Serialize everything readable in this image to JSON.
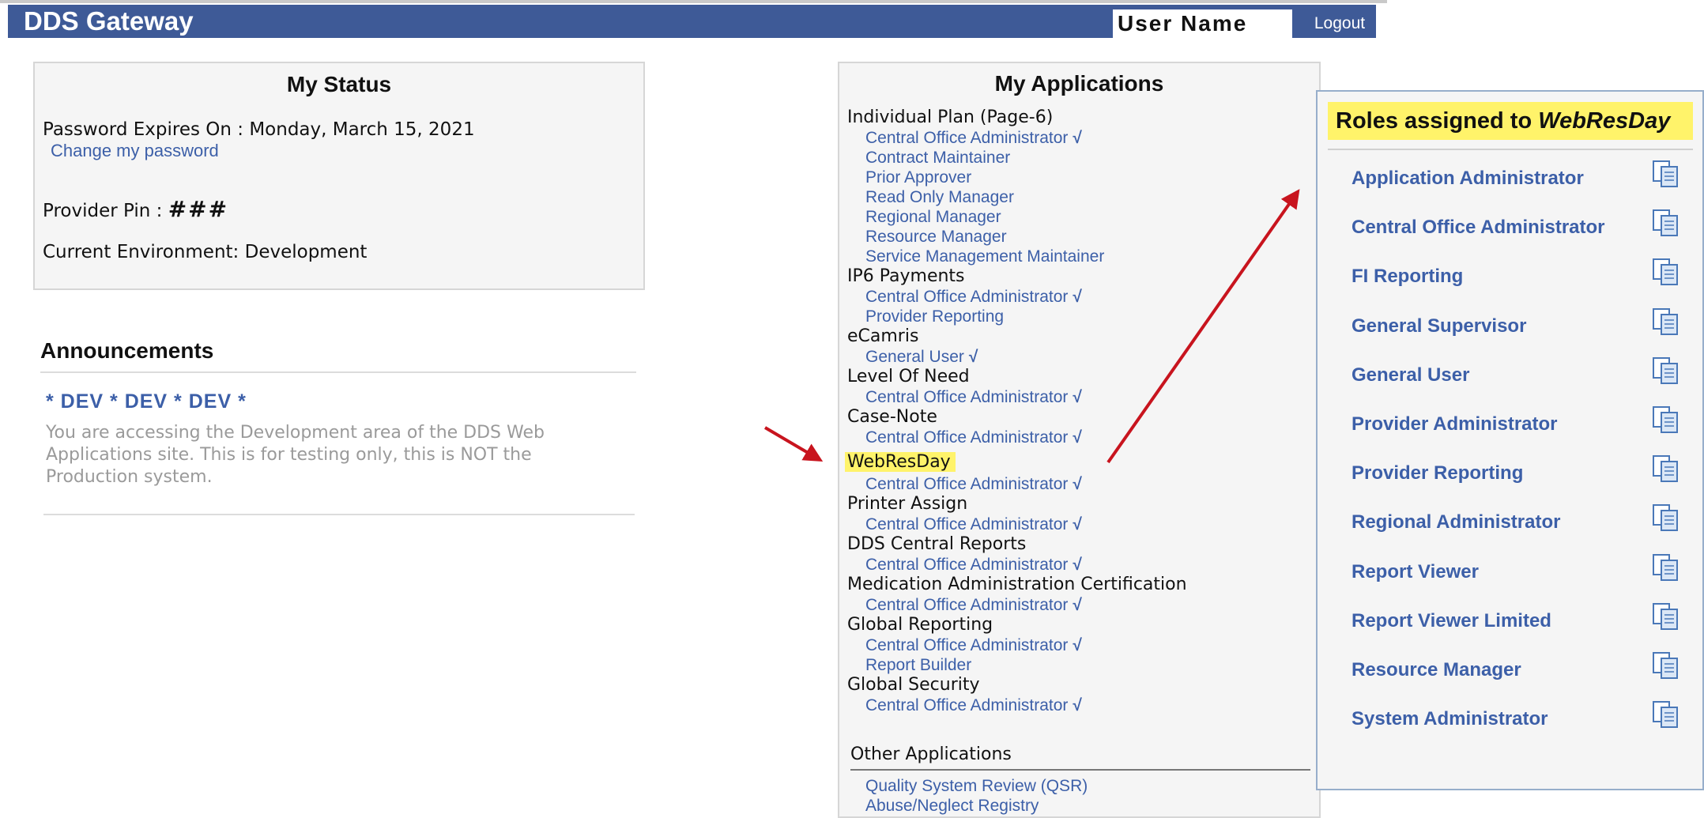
{
  "header": {
    "app_title": "DDS Gateway",
    "user_name": "User Name",
    "logout_label": "Logout"
  },
  "status": {
    "title": "My Status",
    "password_expires": "Password Expires On : Monday, March 15, 2021",
    "change_password": "Change my password",
    "provider_pin_label": "Provider Pin : ",
    "provider_pin_value": "###",
    "environment": "Current Environment: Development"
  },
  "announcements": {
    "title": "Announcements",
    "subtitle": "* DEV * DEV * DEV *",
    "body": "You are accessing the Development area of the DDS Web Applications site. This is for testing only, this is NOT the Production system."
  },
  "applications": {
    "title": "My Applications",
    "groups": [
      {
        "name": "Individual Plan (Page-6)",
        "roles": [
          {
            "label": "Central Office Administrator",
            "check": "√"
          },
          {
            "label": "Contract Maintainer",
            "check": ""
          },
          {
            "label": "Prior Approver",
            "check": ""
          },
          {
            "label": "Read Only Manager",
            "check": ""
          },
          {
            "label": "Regional Manager",
            "check": ""
          },
          {
            "label": "Resource Manager",
            "check": ""
          },
          {
            "label": "Service Management Maintainer",
            "check": ""
          }
        ]
      },
      {
        "name": "IP6 Payments",
        "roles": [
          {
            "label": "Central Office Administrator",
            "check": "√"
          },
          {
            "label": "Provider Reporting",
            "check": ""
          }
        ]
      },
      {
        "name": "eCamris",
        "roles": [
          {
            "label": "General User",
            "check": "√"
          }
        ]
      },
      {
        "name": "Level Of Need",
        "roles": [
          {
            "label": "Central Office Administrator",
            "check": "√"
          }
        ]
      },
      {
        "name": "Case-Note",
        "roles": [
          {
            "label": "Central Office Administrator",
            "check": "√"
          }
        ]
      },
      {
        "name": "WebResDay",
        "roles": [
          {
            "label": "Central Office Administrator",
            "check": "√"
          }
        ]
      },
      {
        "name": "Printer Assign",
        "roles": [
          {
            "label": "Central Office Administrator",
            "check": "√"
          }
        ]
      },
      {
        "name": "DDS Central Reports",
        "roles": [
          {
            "label": "Central Office Administrator",
            "check": "√"
          }
        ]
      },
      {
        "name": "Medication Administration Certification",
        "roles": [
          {
            "label": "Central Office Administrator",
            "check": "√"
          }
        ]
      },
      {
        "name": "Global Reporting",
        "roles": [
          {
            "label": "Central Office Administrator",
            "check": "√"
          },
          {
            "label": "Report Builder",
            "check": ""
          }
        ]
      },
      {
        "name": "Global Security",
        "roles": [
          {
            "label": "Central Office Administrator",
            "check": "√"
          }
        ]
      }
    ],
    "other_title": "Other Applications",
    "other_links": [
      "Quality System Review (QSR)",
      "Abuse/Neglect Registry"
    ]
  },
  "roles_popup": {
    "title_prefix": "Roles assigned to ",
    "title_app": "WebResDay",
    "roles": [
      "Application Administrator",
      "Central Office Administrator",
      "FI Reporting",
      "General Supervisor",
      "General User",
      "Provider Administrator",
      "Provider Reporting",
      "Regional Administrator",
      "Report Viewer",
      "Report Viewer Limited",
      "Resource Manager",
      "System Administrator"
    ],
    "copy_icon": "copy-icon"
  },
  "colors": {
    "header_bg": "#3e5a97",
    "link": "#3c5fa8",
    "highlight": "#fff36a",
    "arrow": "#c8141e"
  }
}
